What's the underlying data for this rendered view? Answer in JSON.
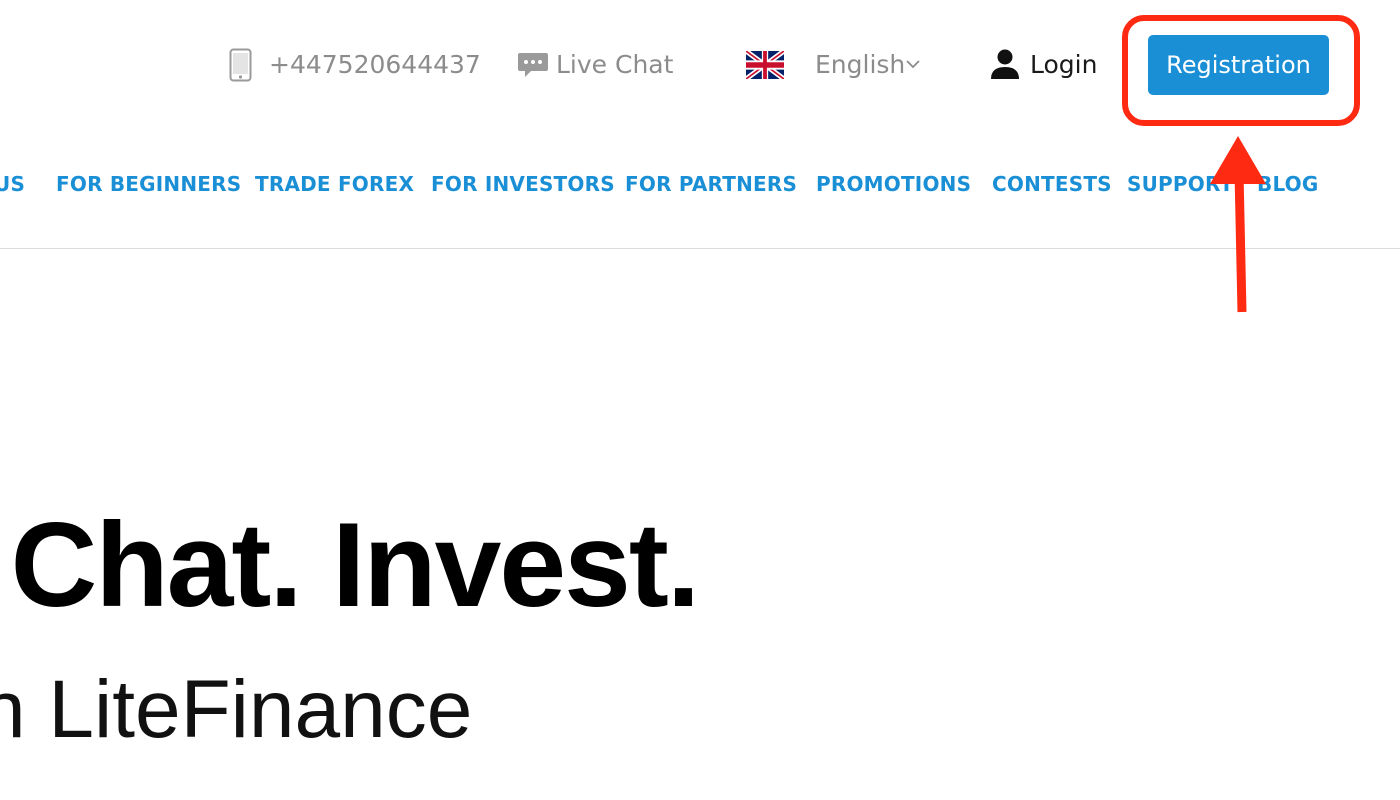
{
  "topbar": {
    "phone": "+447520644437",
    "live_chat": "Live Chat",
    "language": "English",
    "login": "Login",
    "registration": "Registration"
  },
  "nav": {
    "items": [
      "US",
      "FOR BEGINNERS",
      "TRADE FOREX",
      "FOR INVESTORS",
      "FOR PARTNERS",
      "PROMOTIONS",
      "CONTESTS",
      "SUPPORT",
      "BLOG"
    ]
  },
  "hero": {
    "title": ". Chat. Invest.",
    "subtitle": "h LiteFinance"
  },
  "icons": {
    "phone": "phone-icon",
    "chat": "chat-bubble-icon",
    "flag": "uk-flag-icon",
    "chevron": "chevron-down-icon",
    "user": "user-icon"
  },
  "colors": {
    "accent": "#1a8fd6",
    "annotation": "#ff2a12",
    "muted_text": "#8c8c8c"
  }
}
